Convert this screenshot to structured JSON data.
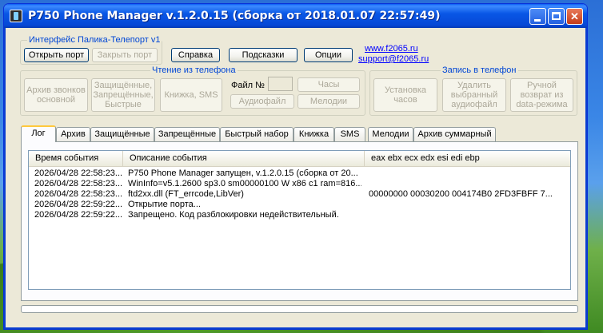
{
  "window": {
    "title": "P750 Phone Manager v.1.2.0.15 (сборка от 2018.01.07 22:57:49)"
  },
  "interface_group": {
    "label": "Интерфейс Палика-Телепорт v1",
    "open_port": "Открыть порт",
    "close_port": "Закрыть порт"
  },
  "top_buttons": {
    "help": "Справка",
    "hints": "Подсказки",
    "options": "Опции"
  },
  "links": {
    "site": "www.f2065.ru",
    "email": "support@f2065.ru"
  },
  "read_group": {
    "label": "Чтение из телефона",
    "call_archive": [
      "Архив звонков",
      "основной"
    ],
    "protected": [
      "Защищённые,",
      "Запрещённые,",
      "Быстрые"
    ],
    "book_sms": "Книжка, SMS",
    "file_label": "Файл №",
    "clock": "Часы",
    "audio_file": "Аудиофайл",
    "melodies": "Мелодии"
  },
  "write_group": {
    "label": "Запись в телефон",
    "set_clock": [
      "Установка",
      "часов"
    ],
    "delete_audio": [
      "Удалить",
      "выбранный",
      "аудиофайл"
    ],
    "manual_return": [
      "Ручной",
      "возврат из",
      "data-режима"
    ]
  },
  "tabs": [
    {
      "label": "Лог",
      "active": true
    },
    {
      "label": "Архив",
      "active": false
    },
    {
      "label": "Защищённые",
      "active": false
    },
    {
      "label": "Запрещённые",
      "active": false
    },
    {
      "label": "Быстрый набор",
      "active": false
    },
    {
      "label": "Книжка",
      "active": false
    },
    {
      "label": "SMS",
      "active": false
    },
    {
      "label": "Мелодии",
      "active": false
    },
    {
      "label": "Архив суммарный",
      "active": false
    }
  ],
  "log": {
    "columns": [
      "Время события",
      "Описание события",
      "eax ebx ecx edx esi edi ebp"
    ],
    "rows": [
      [
        "2026/04/28 22:58:23...",
        "P750 Phone Manager запущен, v.1.2.0.15 (сборка от 20...",
        ""
      ],
      [
        "2026/04/28 22:58:23...",
        "WinInfo=v5.1.2600 sp3.0 sm00000100 W x86 c1 ram=816...",
        ""
      ],
      [
        "2026/04/28 22:58:23...",
        "ftd2xx.dll (FT_errcode,LibVer)",
        "00000000 00030200 004174B0 2FD3FBFF 7..."
      ],
      [
        "2026/04/28 22:59:22...",
        "Открытие порта...",
        ""
      ],
      [
        "2026/04/28 22:59:22...",
        "Запрещено. Код разблокировки недействительный.",
        ""
      ]
    ]
  },
  "colors": {
    "titlebar": "#0054e3",
    "window_bg": "#ece9d8",
    "group_label": "#0046d5",
    "link": "#0000ff"
  }
}
